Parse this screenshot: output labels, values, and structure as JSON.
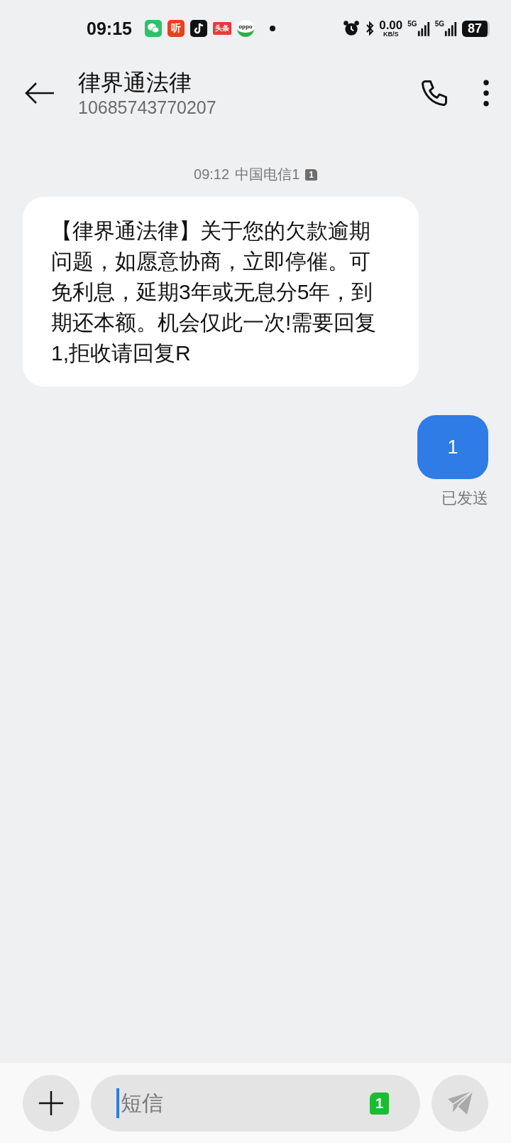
{
  "status_bar": {
    "time": "09:15",
    "app_icons": [
      {
        "kind": "chat"
      },
      {
        "kind": "listen",
        "label": "听"
      },
      {
        "kind": "note"
      },
      {
        "kind": "news",
        "label": "头条"
      },
      {
        "kind": "oppo",
        "label": "oppo"
      }
    ],
    "speed": "0.00",
    "speed_unit": "KB/S",
    "networks": [
      "5G",
      "5G"
    ],
    "battery": "87"
  },
  "header": {
    "title": "律界通法律",
    "number": "10685743770207"
  },
  "messages": [
    {
      "kind": "meta",
      "time": "09:12",
      "carrier": "中国电信1",
      "sim": "1"
    },
    {
      "kind": "received",
      "text": "【律界通法律】关于您的欠款逾期问题，如愿意协商，立即停催。可免利息，延期3年或无息分5年，到期还本额。机会仅此一次!需要回复1,拒收请回复R"
    },
    {
      "kind": "sent",
      "text": "1",
      "status": "已发送"
    }
  ],
  "composer": {
    "placeholder": "短信",
    "sim": "1"
  }
}
